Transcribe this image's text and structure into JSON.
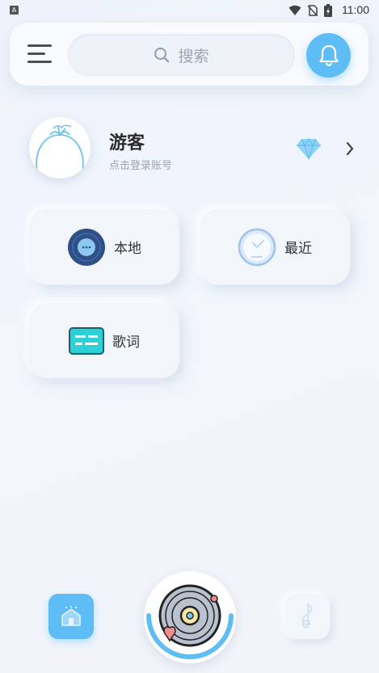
{
  "status_bar": {
    "time": "11:00",
    "indicator": "A"
  },
  "header": {
    "search_placeholder": "搜索"
  },
  "profile": {
    "name": "游客",
    "hint": "点击登录账号"
  },
  "cards": {
    "local": "本地",
    "recent": "最近",
    "lyrics": "歌词"
  },
  "icons": {
    "menu": "menu-icon",
    "search": "search-icon",
    "bell": "bell-icon",
    "vip": "diamond-icon",
    "more": "chevron-right-icon",
    "local": "vinyl-icon",
    "recent": "clock-icon",
    "lyrics": "lyrics-icon",
    "home": "home-icon",
    "player": "record-icon",
    "music": "music-note-icon"
  },
  "colors": {
    "accent": "#5dbdf4",
    "local_icon": "#2f4f86",
    "lyrics_icon": "#2ed0d8",
    "heart": "#f28b8b"
  }
}
